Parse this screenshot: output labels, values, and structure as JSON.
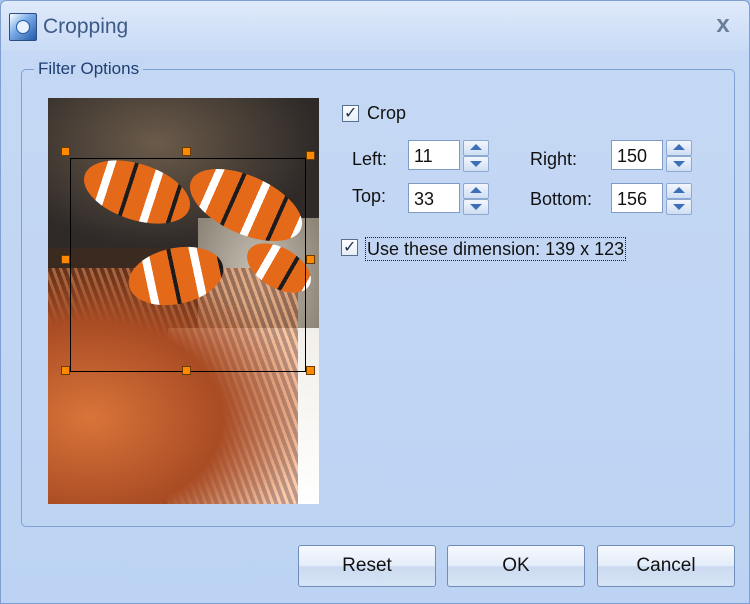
{
  "window": {
    "title": "Cropping",
    "close_glyph": "x"
  },
  "group": {
    "label": "Filter Options"
  },
  "crop": {
    "checkbox_label": "Crop",
    "checked": true,
    "left_label": "Left:",
    "left_value": "11",
    "top_label": "Top:",
    "top_value": "33",
    "right_label": "Right:",
    "right_value": "150",
    "bottom_label": "Bottom:",
    "bottom_value": "156"
  },
  "dimension": {
    "label": "Use these dimension: 139 x 123",
    "checked": true
  },
  "buttons": {
    "reset": "Reset",
    "ok": "OK",
    "cancel": "Cancel"
  },
  "icons": {
    "app": "app-icon",
    "check": "checkmark-icon",
    "spin_up": "arrow-up-icon",
    "spin_down": "arrow-down-icon"
  }
}
